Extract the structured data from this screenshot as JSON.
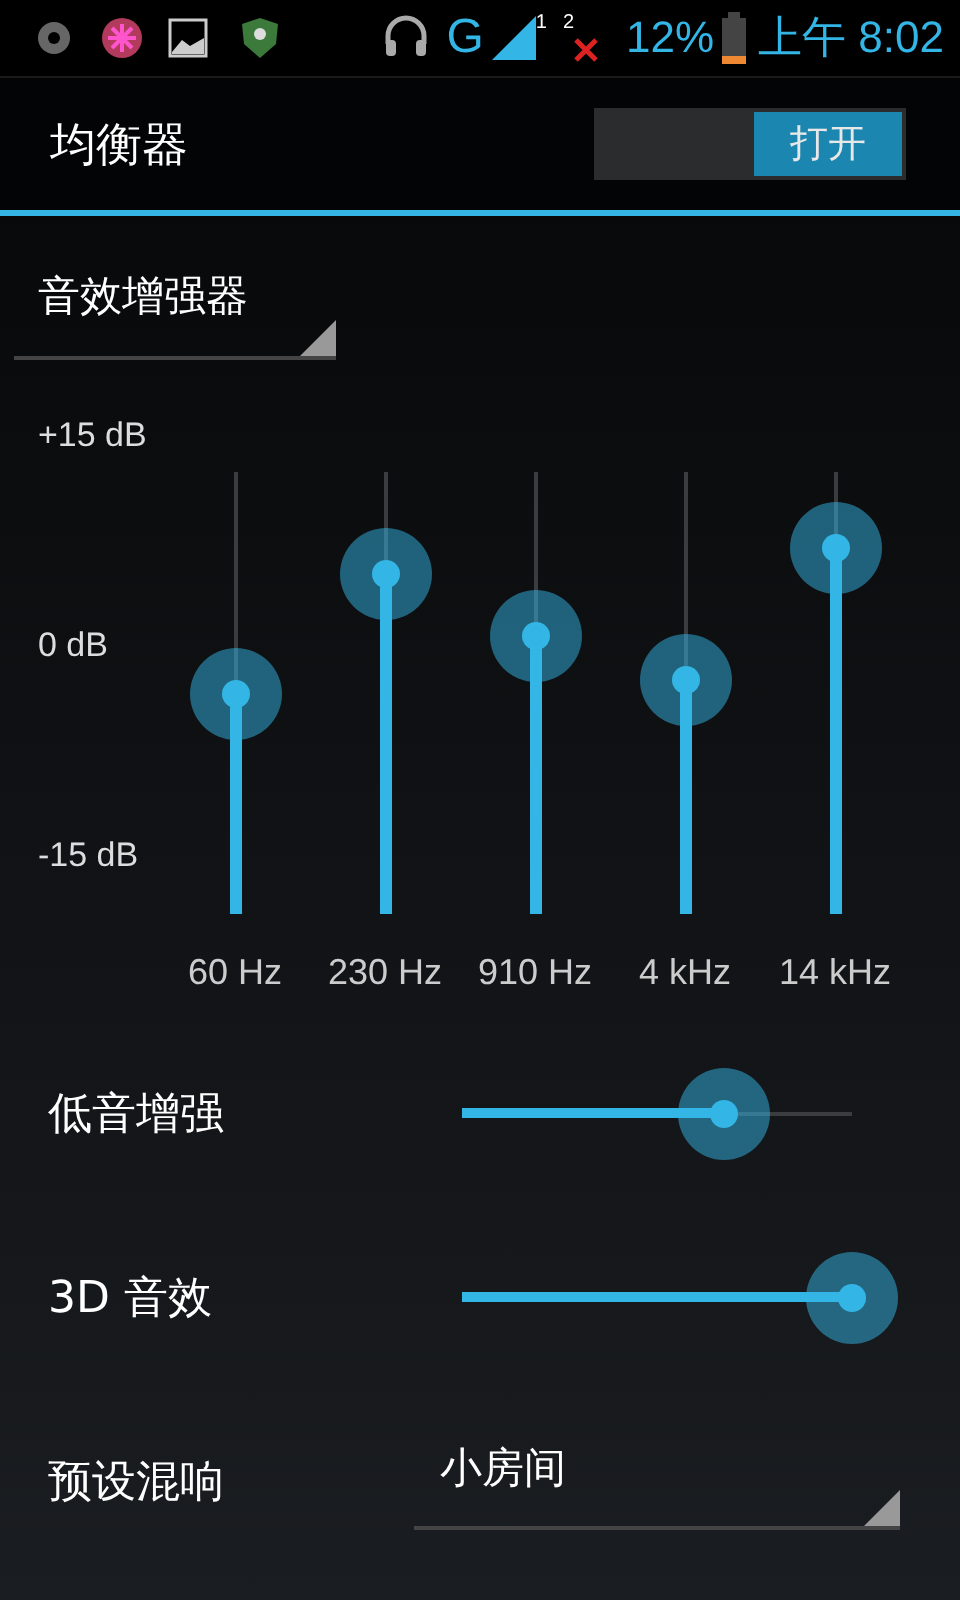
{
  "status_bar": {
    "network": "G",
    "sim_1": "1",
    "sim_2": "2",
    "battery": "12%",
    "time": "上午 8:02"
  },
  "title": "均衡器",
  "power_switch": {
    "label": "打开",
    "on": true
  },
  "preset": {
    "value": "音效增强器"
  },
  "equalizer": {
    "scale": [
      "+15 dB",
      "0 dB",
      "-15 dB"
    ],
    "bands": [
      {
        "label": "60 Hz",
        "level": 0.5
      },
      {
        "label": "230 Hz",
        "level": 0.77
      },
      {
        "label": "910 Hz",
        "level": 0.63
      },
      {
        "label": "4 kHz",
        "level": 0.53
      },
      {
        "label": "14 kHz",
        "level": 0.83
      }
    ]
  },
  "settings": [
    {
      "kind": "slider",
      "label": "低音增强",
      "level": 0.67
    },
    {
      "kind": "slider",
      "label": "3D 音效",
      "level": 1
    },
    {
      "kind": "dropdown",
      "label": "预设混响",
      "value": "小房间"
    }
  ]
}
